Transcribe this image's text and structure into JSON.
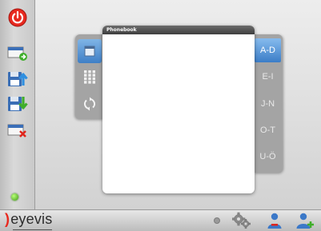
{
  "window": {
    "title": "Phonebook"
  },
  "sidebar": {
    "items": [
      {
        "name": "power",
        "icon": "power-icon"
      },
      {
        "name": "open",
        "icon": "tray-arrow-icon"
      },
      {
        "name": "upload",
        "icon": "save-upload-icon"
      },
      {
        "name": "download",
        "icon": "save-download-icon"
      },
      {
        "name": "delete",
        "icon": "tray-delete-icon"
      }
    ],
    "status_color": "#3f9b12"
  },
  "phonebook": {
    "view_tabs": [
      {
        "name": "list-view",
        "icon": "list-card-icon",
        "active": true
      },
      {
        "name": "keypad-view",
        "icon": "keypad-icon",
        "active": false
      },
      {
        "name": "refresh",
        "icon": "refresh-icon",
        "active": false
      }
    ],
    "letter_tabs": [
      "A-D",
      "E-I",
      "J-N",
      "O-T",
      "U-Ö"
    ],
    "active_letter_tab": "A-D"
  },
  "bottombar": {
    "logo": "eyevis",
    "icons": [
      "status-dot-icon",
      "settings-icon",
      "user-icon",
      "add-user-icon"
    ]
  },
  "colors": {
    "accent": "#3f7fc6",
    "brand_red": "#e8291f"
  }
}
